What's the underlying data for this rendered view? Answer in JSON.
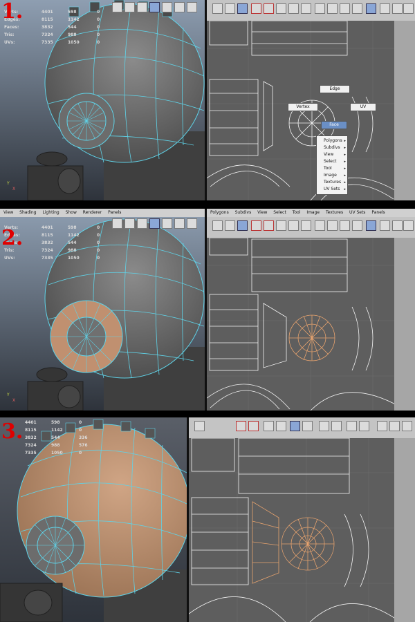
{
  "steps": [
    "1.",
    "2.",
    "3."
  ],
  "hud": {
    "labels": [
      "Verts:",
      "Edges:",
      "Faces:",
      "Tris:",
      "UVs:"
    ],
    "values": [
      [
        "4401",
        "598",
        "0"
      ],
      [
        "8115",
        "1142",
        "0"
      ],
      [
        "3832",
        "544",
        "0"
      ],
      [
        "7324",
        "988",
        "0"
      ],
      [
        "7335",
        "1050",
        "0"
      ]
    ],
    "values_step3": [
      [
        "4401",
        "598",
        "0"
      ],
      [
        "8115",
        "1142",
        "0"
      ],
      [
        "3832",
        "544",
        "336"
      ],
      [
        "7324",
        "988",
        "576"
      ],
      [
        "7335",
        "1050",
        "0"
      ]
    ]
  },
  "viewport_menu": [
    "View",
    "Shading",
    "Lighting",
    "Show",
    "Renderer",
    "Panels"
  ],
  "uv_menu": [
    "Polygons",
    "Subdivs",
    "View",
    "Select",
    "Tool",
    "Image",
    "Textures",
    "UV Sets",
    "Panels"
  ],
  "marking_menu": {
    "edge": "Edge",
    "vertex": "Vertex",
    "uv": "UV",
    "face": "Face",
    "items": [
      "Polygons",
      "Subdivs",
      "View",
      "Select",
      "Tool",
      "Image",
      "Textures",
      "UV Sets"
    ]
  },
  "axis": {
    "y": "Y",
    "x": "X"
  },
  "colors": {
    "wire": "#5fd3e8",
    "selected_face": "#c09070",
    "selected_uv": "#e7a36e",
    "uv_bg": "#5e5e5e",
    "red_number": "#e00000"
  }
}
